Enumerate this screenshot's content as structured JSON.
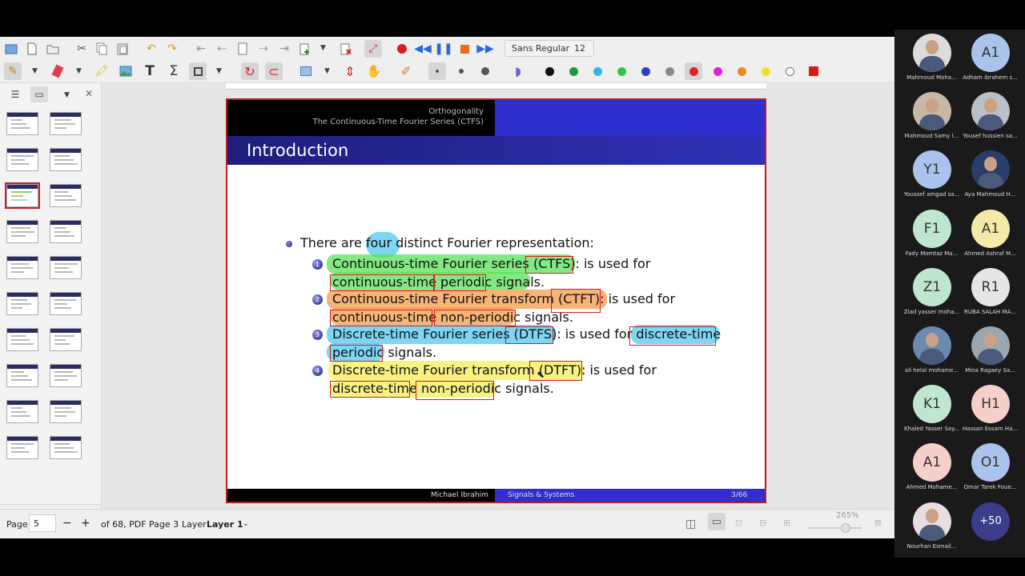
{
  "toolbar": {
    "font_name": "Sans Regular",
    "font_size": "12",
    "pen_colors": [
      "#111111",
      "#1f9a3a",
      "#33b6e8",
      "#35c545",
      "#2a40c8",
      "#8a8a8a",
      "#e02424",
      "#e020d8",
      "#f08a1c",
      "#f2e21c",
      "#ffffff",
      "#e01818"
    ]
  },
  "sidebar": {
    "thumb_count": 20,
    "selected_index": 4
  },
  "slide": {
    "section": "Orthogonality",
    "subsection": "The Continuous-Time Fourier Series (CTFS)",
    "frame_title": "Introduction",
    "intro": {
      "before": "There are",
      "four": "four",
      "after": "distinct Fourier representation:"
    },
    "items": [
      {
        "num": "1",
        "name": "Continuous-time Fourier series",
        "abbr": "(CTFS)",
        "used": ": is used for",
        "w1": "continuous-time",
        "w2": "periodic",
        "tail": "signals."
      },
      {
        "num": "2",
        "name": "Continuous-time Fourier transform",
        "abbr": "(CTFT)",
        "used": ": is used for",
        "w1": "continuous-time",
        "w2": "non-periodic",
        "tail": "signals."
      },
      {
        "num": "3",
        "name": "Discrete-time Fourier series",
        "abbr": "(DTFS)",
        "used": ": is used for",
        "w1": "discrete-time",
        "w2": "periodic",
        "tail": "signals."
      },
      {
        "num": "4",
        "name": "Discrete-time Fourier transform",
        "abbr": "(DTFT)",
        "used": ": is used for",
        "w1": "discrete-time",
        "w2": "non-periodic",
        "tail": "signals."
      }
    ],
    "footer_author": "Michael Ibrahim",
    "footer_course": "Signals & Systems",
    "footer_page": "3/66"
  },
  "statusbar": {
    "page_label": "Page",
    "page_value": "5",
    "page_minus": "−",
    "page_plus": "+",
    "page_of": "of 68, PDF Page 3",
    "layer_label": "Layer",
    "layer_value": "Layer 1",
    "zoom": "265%"
  },
  "participants": [
    {
      "name": "Mahmoud Moha...",
      "initials": "",
      "bg": "#dcdcdc",
      "photo": true
    },
    {
      "name": "Adham ibrahem s...",
      "initials": "A1",
      "bg": "#aac3ec",
      "photo": false
    },
    {
      "name": "Mahmoud Samy I...",
      "initials": "",
      "bg": "#c9b8a6",
      "photo": true
    },
    {
      "name": "Yousef hussien sa...",
      "initials": "",
      "bg": "#b8c0c8",
      "photo": true
    },
    {
      "name": "Youssef amgad sa...",
      "initials": "Y1",
      "bg": "#aac3ec",
      "photo": false
    },
    {
      "name": "Aya Mahmoud H...",
      "initials": "",
      "bg": "#2a3d6a",
      "photo": true
    },
    {
      "name": "Fady Momtaz Ma...",
      "initials": "F1",
      "bg": "#bfe6cf",
      "photo": false
    },
    {
      "name": "Ahmed Ashraf M...",
      "initials": "A1",
      "bg": "#f5e9a8",
      "photo": false
    },
    {
      "name": "Ziad yasser moha...",
      "initials": "Z1",
      "bg": "#bfe6cf",
      "photo": false
    },
    {
      "name": "RUBA SALAH MA...",
      "initials": "R1",
      "bg": "#e6e6e6",
      "photo": false
    },
    {
      "name": "ali helal mohame...",
      "initials": "",
      "bg": "#6a8ab0",
      "photo": true
    },
    {
      "name": "Mina Ragaey Sa...",
      "initials": "",
      "bg": "#9aa7b0",
      "photo": true
    },
    {
      "name": "Khaled Yasser Say...",
      "initials": "K1",
      "bg": "#bfe6cf",
      "photo": false
    },
    {
      "name": "Hassan Essam Ha...",
      "initials": "H1",
      "bg": "#f6cfc9",
      "photo": false
    },
    {
      "name": "Ahmed Mohame...",
      "initials": "A1",
      "bg": "#f6cfc9",
      "photo": false
    },
    {
      "name": "Omar Tarek Foue...",
      "initials": "O1",
      "bg": "#aac3ec",
      "photo": false
    },
    {
      "name": "Nourhan Esmail...",
      "initials": "",
      "bg": "#e8dde0",
      "photo": true
    },
    {
      "name": "",
      "initials": "+50",
      "bg": "#3a3d8a",
      "photo": false
    }
  ]
}
